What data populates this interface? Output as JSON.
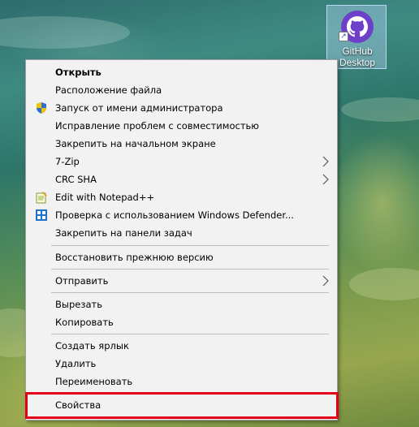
{
  "desktop_icon": {
    "label_line1": "GitHub",
    "label_line2": "Desktop",
    "icon": "github-octocat-icon",
    "shortcut_glyph": "↗"
  },
  "context_menu": {
    "items": [
      {
        "label": "Открыть",
        "bold": true
      },
      {
        "label": "Расположение файла"
      },
      {
        "label": "Запуск от имени администратора",
        "icon": "uac-shield-icon"
      },
      {
        "label": "Исправление проблем с совместимостью"
      },
      {
        "label": "Закрепить на начальном экране"
      },
      {
        "label": "7-Zip",
        "submenu": true
      },
      {
        "label": "CRC SHA",
        "submenu": true
      },
      {
        "label": "Edit with Notepad++",
        "icon": "notepad-plus-plus-icon"
      },
      {
        "label": "Проверка с использованием Windows Defender...",
        "icon": "windows-defender-icon"
      },
      {
        "label": "Закрепить на панели задач"
      },
      {
        "label": "Восстановить прежнюю версию"
      },
      {
        "label": "Отправить",
        "submenu": true
      },
      {
        "label": "Вырезать"
      },
      {
        "label": "Копировать"
      },
      {
        "label": "Создать ярлык"
      },
      {
        "label": "Удалить"
      },
      {
        "label": "Переименовать"
      },
      {
        "label": "Свойства",
        "highlighted": true
      }
    ]
  },
  "colors": {
    "highlight_border": "#e5001a",
    "menu_background": "#f2f2f2",
    "github_purple": "#6e40c9"
  }
}
